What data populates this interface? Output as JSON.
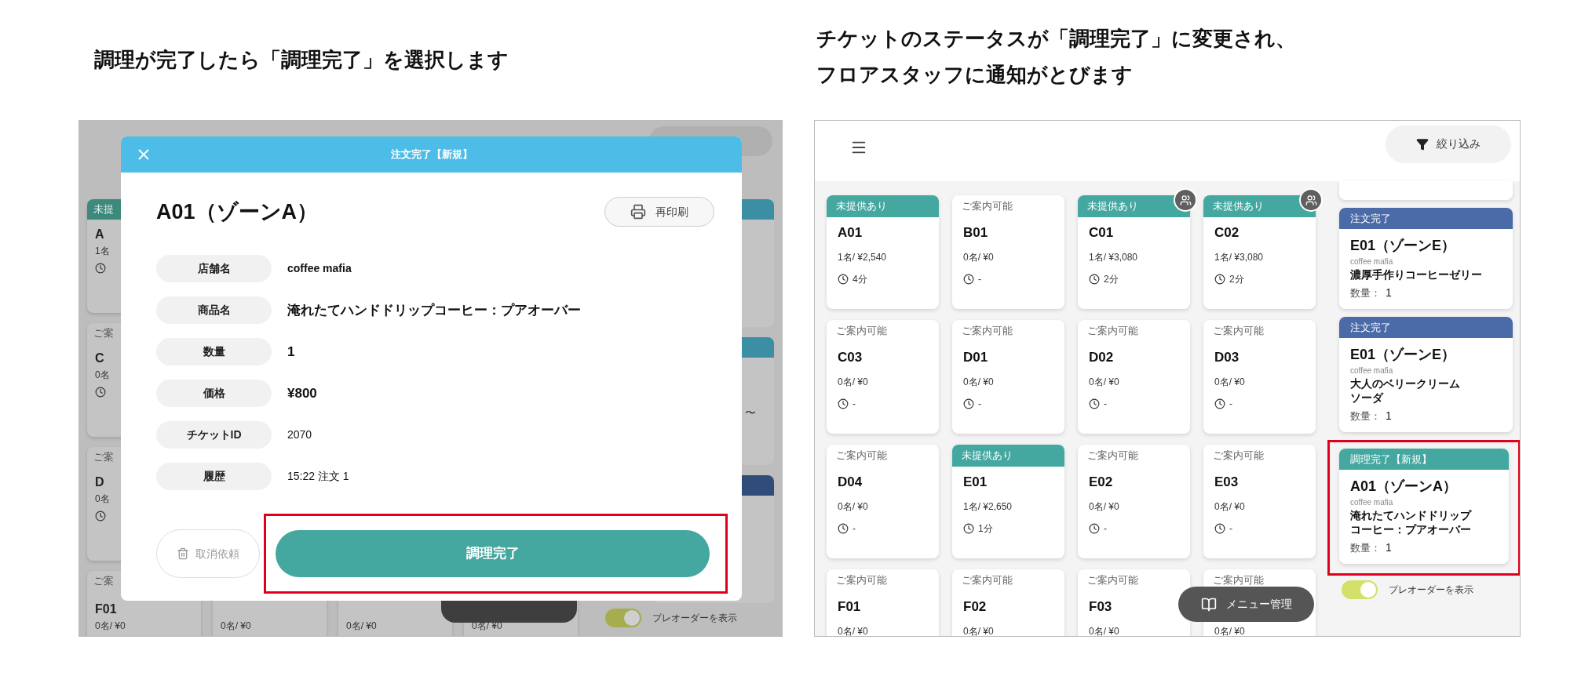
{
  "left": {
    "caption": "調理が完了したら「調理完了」を選択します",
    "background": {
      "side_cards": [
        {
          "kind": "unserved",
          "status": "未提",
          "name": "A",
          "info": "1名",
          "clock": true
        },
        {
          "kind": "available",
          "status": "ご案",
          "name": "C",
          "info": "0名",
          "clock": true
        },
        {
          "kind": "available",
          "status": "ご案",
          "name": "D",
          "info": "0名",
          "clock": true
        },
        {
          "kind": "available",
          "status": "ご案",
          "name": "F01",
          "info": "0名/ ¥0"
        }
      ],
      "bottom_cards": [
        {
          "info": "0名/ ¥0"
        },
        {
          "info": "0名/ ¥0"
        },
        {
          "info": "0名/ ¥0"
        }
      ],
      "order_strip": [
        {
          "color": "#3b8ea3"
        },
        {
          "color": "#3b8ea3",
          "text": "〜"
        },
        {
          "color": "#2f4d78"
        }
      ],
      "preorder_toggle": {
        "on": true,
        "label": "プレオーダーを表示"
      }
    },
    "dialog": {
      "title": "注文完了【新規】",
      "heading": "A01（ゾーンA）",
      "reprint": "再印刷",
      "rows": [
        {
          "label": "店舗名",
          "value": "coffee mafia",
          "kind": "name"
        },
        {
          "label": "商品名",
          "value": "淹れたてハンドドリップコーヒー：プアオーバー",
          "kind": "emphasis"
        },
        {
          "label": "数量",
          "value": "1",
          "kind": "emphasis"
        },
        {
          "label": "価格",
          "value": "¥800",
          "kind": "emphasis"
        },
        {
          "label": "チケットID",
          "value": "2070",
          "kind": "plain"
        },
        {
          "label": "履歴",
          "value": "15:22  注文 1",
          "kind": "plain"
        }
      ],
      "cancel_button": {
        "label": "取消依頼",
        "disabled": true
      },
      "primary_button": {
        "label": "調理完了",
        "highlighted": true
      }
    }
  },
  "right": {
    "caption": [
      "チケットのステータスが「調理完了」に変更され、",
      "フロアスタッフに通知がとびます"
    ],
    "filter_button": "絞り込み",
    "tables": [
      {
        "kind": "unserved",
        "status": "未提供あり",
        "name": "A01",
        "info": "1名/ ¥2,540",
        "time": "4分",
        "group": false
      },
      {
        "kind": "available",
        "status": "ご案内可能",
        "name": "B01",
        "info": "0名/ ¥0",
        "time": "-",
        "group": false
      },
      {
        "kind": "unserved",
        "status": "未提供あり",
        "name": "C01",
        "info": "1名/ ¥3,080",
        "time": "2分",
        "group": true
      },
      {
        "kind": "unserved",
        "status": "未提供あり",
        "name": "C02",
        "info": "1名/ ¥3,080",
        "time": "2分",
        "group": true
      },
      {
        "kind": "available",
        "status": "ご案内可能",
        "name": "C03",
        "info": "0名/ ¥0",
        "time": "-",
        "group": false
      },
      {
        "kind": "available",
        "status": "ご案内可能",
        "name": "D01",
        "info": "0名/ ¥0",
        "time": "-",
        "group": false
      },
      {
        "kind": "available",
        "status": "ご案内可能",
        "name": "D02",
        "info": "0名/ ¥0",
        "time": "-",
        "group": false
      },
      {
        "kind": "available",
        "status": "ご案内可能",
        "name": "D03",
        "info": "0名/ ¥0",
        "time": "-",
        "group": false
      },
      {
        "kind": "available",
        "status": "ご案内可能",
        "name": "D04",
        "info": "0名/ ¥0",
        "time": "-",
        "group": false
      },
      {
        "kind": "unserved",
        "status": "未提供あり",
        "name": "E01",
        "info": "1名/ ¥2,650",
        "time": "1分",
        "group": false
      },
      {
        "kind": "available",
        "status": "ご案内可能",
        "name": "E02",
        "info": "0名/ ¥0",
        "time": "-",
        "group": false
      },
      {
        "kind": "available",
        "status": "ご案内可能",
        "name": "E03",
        "info": "0名/ ¥0",
        "time": "-",
        "group": false
      },
      {
        "kind": "available",
        "status": "ご案内可能",
        "name": "F01",
        "info": "0名/ ¥0",
        "group": false
      },
      {
        "kind": "available",
        "status": "ご案内可能",
        "name": "F02",
        "info": "0名/ ¥0",
        "group": false
      },
      {
        "kind": "available",
        "status": "ご案内可能",
        "name": "F03",
        "info": "0名/ ¥0",
        "group": false
      },
      {
        "kind": "available",
        "status": "ご案内可能",
        "info": "0名/ ¥0",
        "group": false
      }
    ],
    "orders": [
      {
        "status": "注文完了",
        "color": "#4a6aa8",
        "title": "E01（ゾーンE）",
        "shop": "coffee mafia",
        "item_lines": [
          "濃厚手作りコーヒーゼリー"
        ],
        "quantity_label": "数量：",
        "quantity": "1",
        "highlighted": false
      },
      {
        "status": "注文完了",
        "color": "#4a6aa8",
        "title": "E01（ゾーンE）",
        "shop": "coffee mafia",
        "item_lines": [
          "大人のベリークリーム",
          "ソーダ"
        ],
        "quantity_label": "数量：",
        "quantity": "1",
        "highlighted": false
      },
      {
        "status": "調理完了【新規】",
        "color": "#45a8a0",
        "title": "A01（ゾーンA）",
        "shop": "coffee mafia",
        "item_lines": [
          "淹れたてハンドドリップ",
          "コーヒー：プアオーバー"
        ],
        "quantity_label": "数量：",
        "quantity": "1",
        "highlighted": true
      }
    ],
    "menu_button": "メニュー管理",
    "preorder_toggle": {
      "on": true,
      "label": "プレオーダーを表示"
    }
  }
}
